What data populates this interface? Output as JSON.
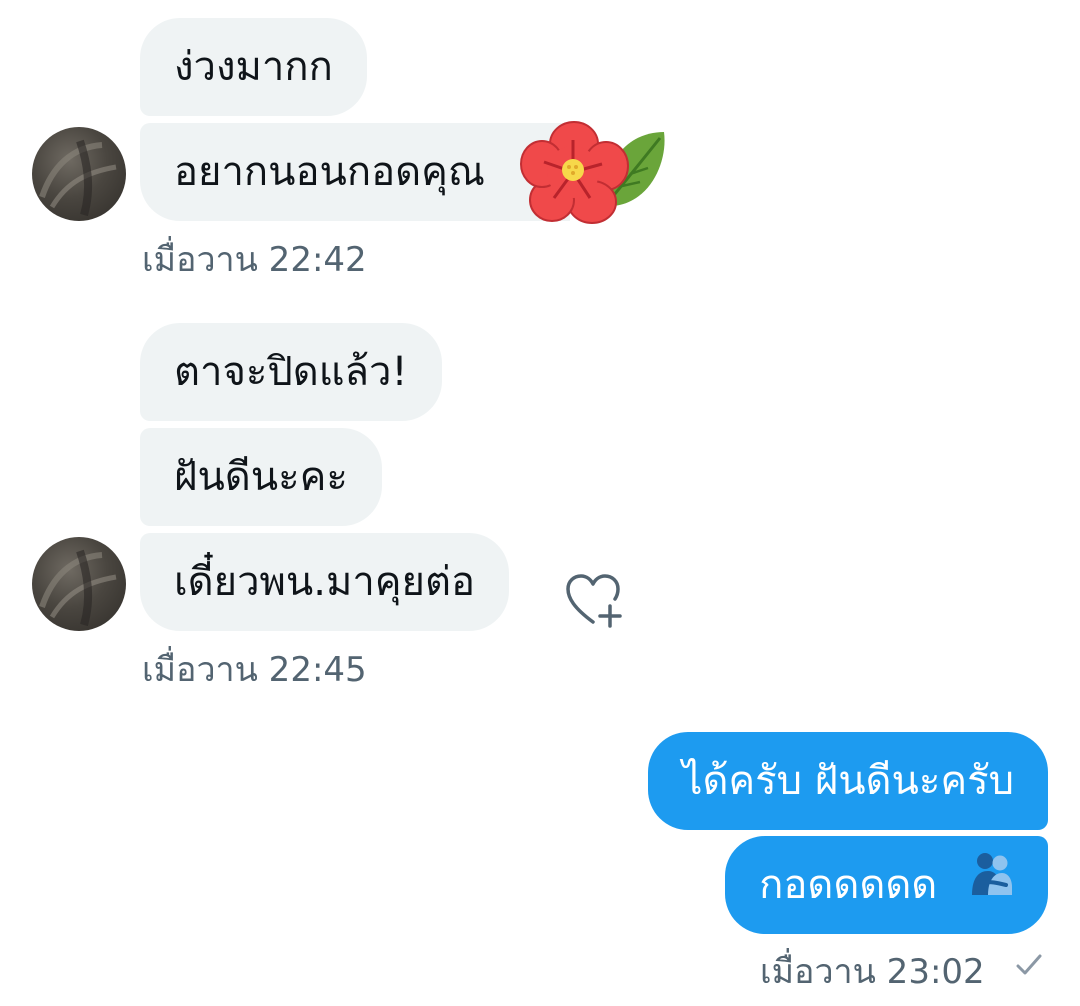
{
  "group1": {
    "messages": [
      "ง่วงมากก",
      "อยากนอนกอดคุณ"
    ],
    "time": "เมื่อวาน 22:42"
  },
  "group2": {
    "messages": [
      "ตาจะปิดแล้ว!",
      "ฝันดีนะคะ",
      "เดี๋ยวพน.มาคุยต่อ"
    ],
    "time": "เมื่อวาน 22:45"
  },
  "group3": {
    "messages": [
      "ได้ครับ ฝันดีนะครับ",
      "กอดดดดด"
    ],
    "time": "เมื่อวาน 23:02"
  },
  "icons": {
    "flower_sticker": "hibiscus-sticker-icon",
    "react": "heart-plus-icon",
    "hug_emoji": "people-hugging-icon",
    "read_receipt": "check-icon"
  },
  "colors": {
    "incoming_bubble": "#eff3f4",
    "outgoing_bubble": "#1d9bf0",
    "timestamp": "#536471"
  }
}
